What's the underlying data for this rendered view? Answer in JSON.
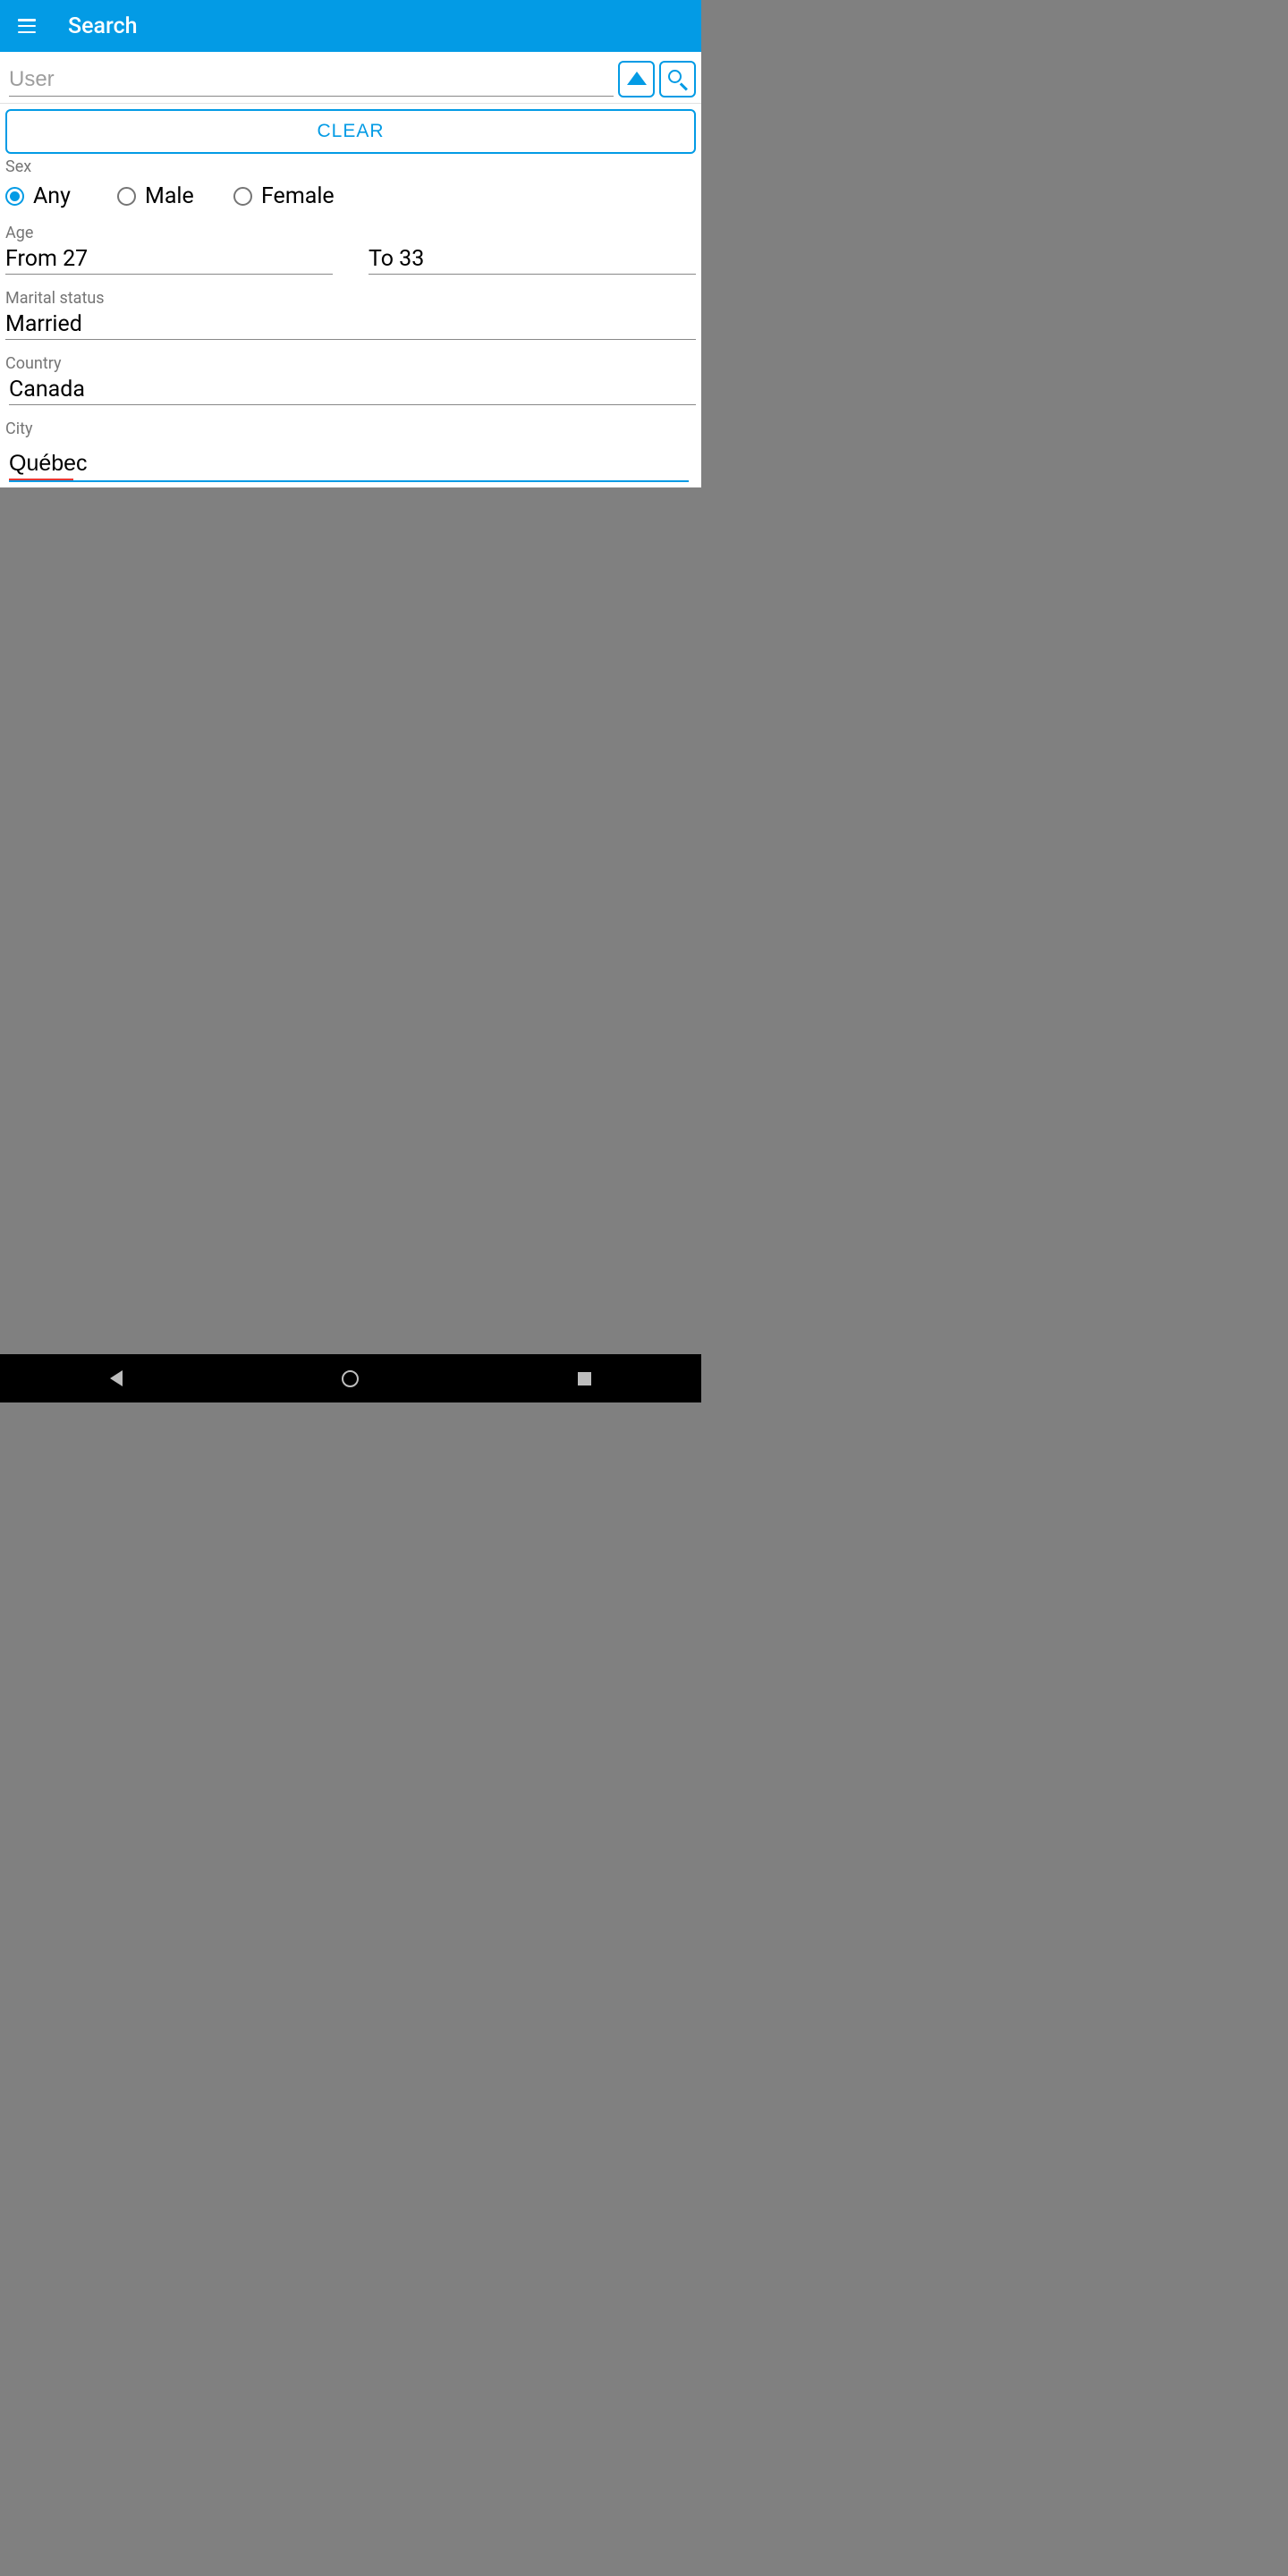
{
  "appbar": {
    "title": "Search"
  },
  "search": {
    "placeholder": "User",
    "value": ""
  },
  "clear_label": "CLEAR",
  "sex": {
    "label": "Sex",
    "options": [
      "Any",
      "Male",
      "Female"
    ],
    "selected": "Any"
  },
  "age": {
    "label": "Age",
    "from": "From 27",
    "to": "To 33"
  },
  "marital": {
    "label": "Marital status",
    "value": "Married"
  },
  "country": {
    "label": "Country",
    "value": "Canada"
  },
  "city": {
    "label": "City",
    "value": "Québec"
  },
  "colors": {
    "accent": "#039be5"
  }
}
